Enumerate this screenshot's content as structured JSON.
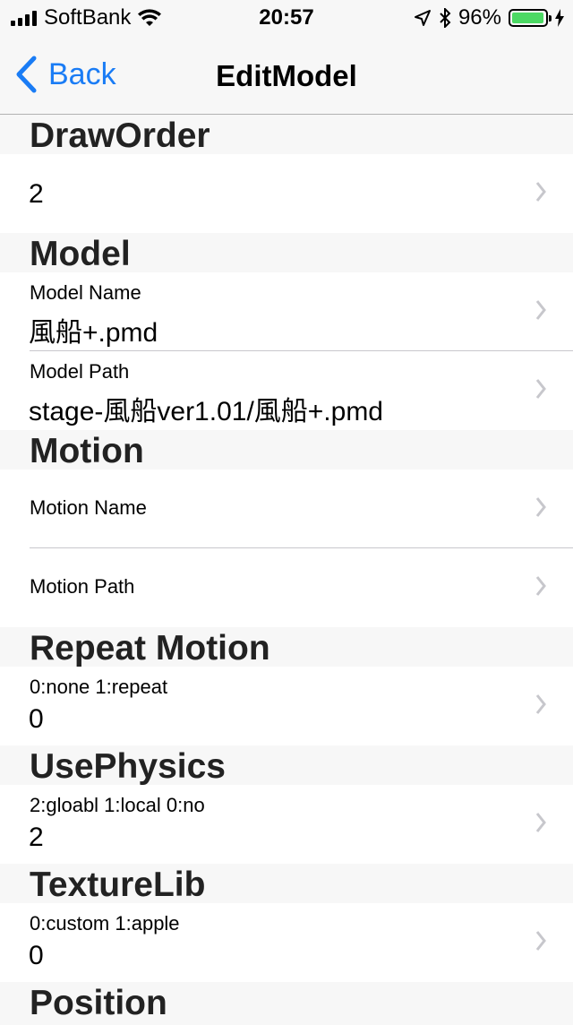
{
  "status": {
    "carrier": "SoftBank",
    "time": "20:57",
    "battery": "96%"
  },
  "nav": {
    "back_label": "Back",
    "title": "EditModel"
  },
  "sections": {
    "draworder": {
      "header": "DrawOrder",
      "value": "2"
    },
    "model": {
      "header": "Model",
      "name_label": "Model Name",
      "name_value": "風船+.pmd",
      "path_label": "Model Path",
      "path_value": "stage-風船ver1.01/風船+.pmd"
    },
    "motion": {
      "header": "Motion",
      "name_label": "Motion Name",
      "path_label": "Motion Path"
    },
    "repeat": {
      "header": "Repeat Motion",
      "label": "0:none 1:repeat",
      "value": "0"
    },
    "physics": {
      "header": "UsePhysics",
      "label": "2:gloabl 1:local 0:no",
      "value": "2"
    },
    "texturelib": {
      "header": "TextureLib",
      "label": "0:custom 1:apple",
      "value": "0"
    },
    "position": {
      "header": "Position"
    }
  },
  "colors": {
    "accent": "#1a7cf5",
    "battery": "#4cd964",
    "chevron": "#c7c7cc"
  },
  "icons": [
    "signal-icon",
    "wifi-icon",
    "location-icon",
    "bluetooth-icon",
    "battery-icon",
    "charging-icon",
    "back-chevron-icon",
    "chevron-right-icon"
  ]
}
